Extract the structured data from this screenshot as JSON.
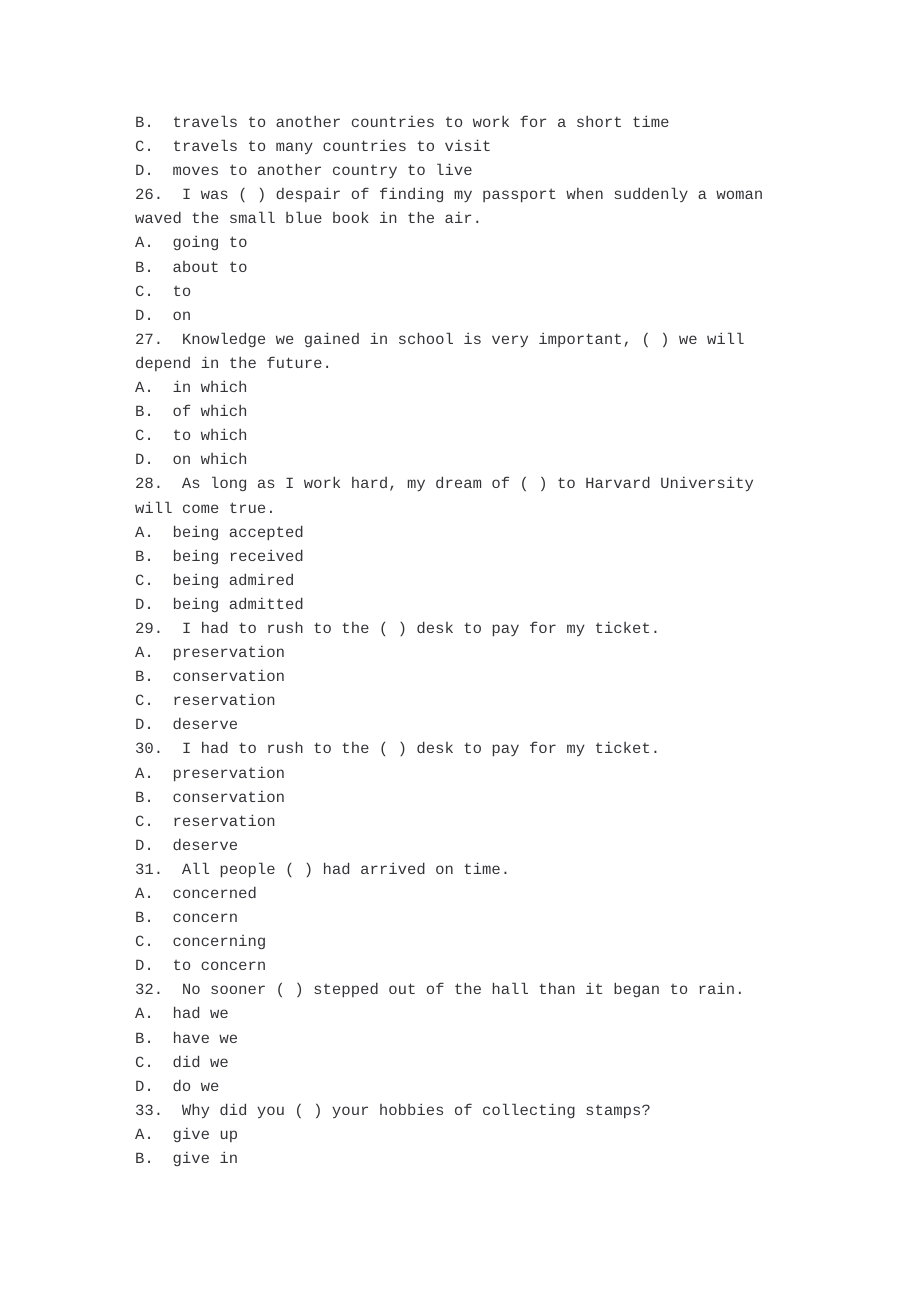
{
  "document": {
    "type": "exam-worksheet",
    "background_color": "#ffffff",
    "text_color": "#25242a",
    "lines": [
      "B.  travels to another countries to work for a short time",
      "C.  travels to many countries to visit",
      "D.  moves to another country to live",
      "26.  I was ( ) despair of finding my passport when suddenly a woman",
      "waved the small blue book in the air.",
      "A.  going to",
      "B.  about to",
      "C.  to",
      "D.  on",
      "27.  Knowledge we gained in school is very important, ( ) we will",
      "depend in the future.",
      "A.  in which",
      "B.  of which",
      "C.  to which",
      "D.  on which",
      "28.  As long as I work hard, my dream of ( ) to Harvard University",
      "will come true.",
      "A.  being accepted",
      "B.  being received",
      "C.  being admired",
      "D.  being admitted",
      "29.  I had to rush to the ( ) desk to pay for my ticket.",
      "A.  preservation",
      "B.  conservation",
      "C.  reservation",
      "D.  deserve",
      "30.  I had to rush to the ( ) desk to pay for my ticket.",
      "A.  preservation",
      "B.  conservation",
      "C.  reservation",
      "D.  deserve",
      "31.  All people ( ) had arrived on time.",
      "A.  concerned",
      "B.  concern",
      "C.  concerning",
      "D.  to concern",
      "32.  No sooner ( ) stepped out of the hall than it began to rain.",
      "A.  had we",
      "B.  have we",
      "C.  did we",
      "D.  do we",
      "33.  Why did you ( ) your hobbies of collecting stamps?",
      "A.  give up",
      "B.  give in"
    ],
    "questions": [
      {
        "number": "",
        "stem": "",
        "options": [
          "B.  travels to another countries to work for a short time",
          "C.  travels to many countries to visit",
          "D.  moves to another country to live"
        ]
      },
      {
        "number": "26.",
        "stem": "I was ( ) despair of finding my passport when suddenly a woman waved the small blue book in the air.",
        "options": [
          "A.  going to",
          "B.  about to",
          "C.  to",
          "D.  on"
        ]
      },
      {
        "number": "27.",
        "stem": "Knowledge we gained in school is very important, ( ) we will depend in the future.",
        "options": [
          "A.  in which",
          "B.  of which",
          "C.  to which",
          "D.  on which"
        ]
      },
      {
        "number": "28.",
        "stem": "As long as I work hard, my dream of ( ) to Harvard University will come true.",
        "options": [
          "A.  being accepted",
          "B.  being received",
          "C.  being admired",
          "D.  being admitted"
        ]
      },
      {
        "number": "29.",
        "stem": "I had to rush to the ( ) desk to pay for my ticket.",
        "options": [
          "A.  preservation",
          "B.  conservation",
          "C.  reservation",
          "D.  deserve"
        ]
      },
      {
        "number": "30.",
        "stem": "I had to rush to the ( ) desk to pay for my ticket.",
        "options": [
          "A.  preservation",
          "B.  conservation",
          "C.  reservation",
          "D.  deserve"
        ]
      },
      {
        "number": "31.",
        "stem": "All people ( ) had arrived on time.",
        "options": [
          "A.  concerned",
          "B.  concern",
          "C.  concerning",
          "D.  to concern"
        ]
      },
      {
        "number": "32.",
        "stem": "No sooner ( ) stepped out of the hall than it began to rain.",
        "options": [
          "A.  had we",
          "B.  have we",
          "C.  did we",
          "D.  do we"
        ]
      },
      {
        "number": "33.",
        "stem": "Why did you ( ) your hobbies of collecting stamps?",
        "options": [
          "A.  give up",
          "B.  give in"
        ]
      }
    ]
  }
}
